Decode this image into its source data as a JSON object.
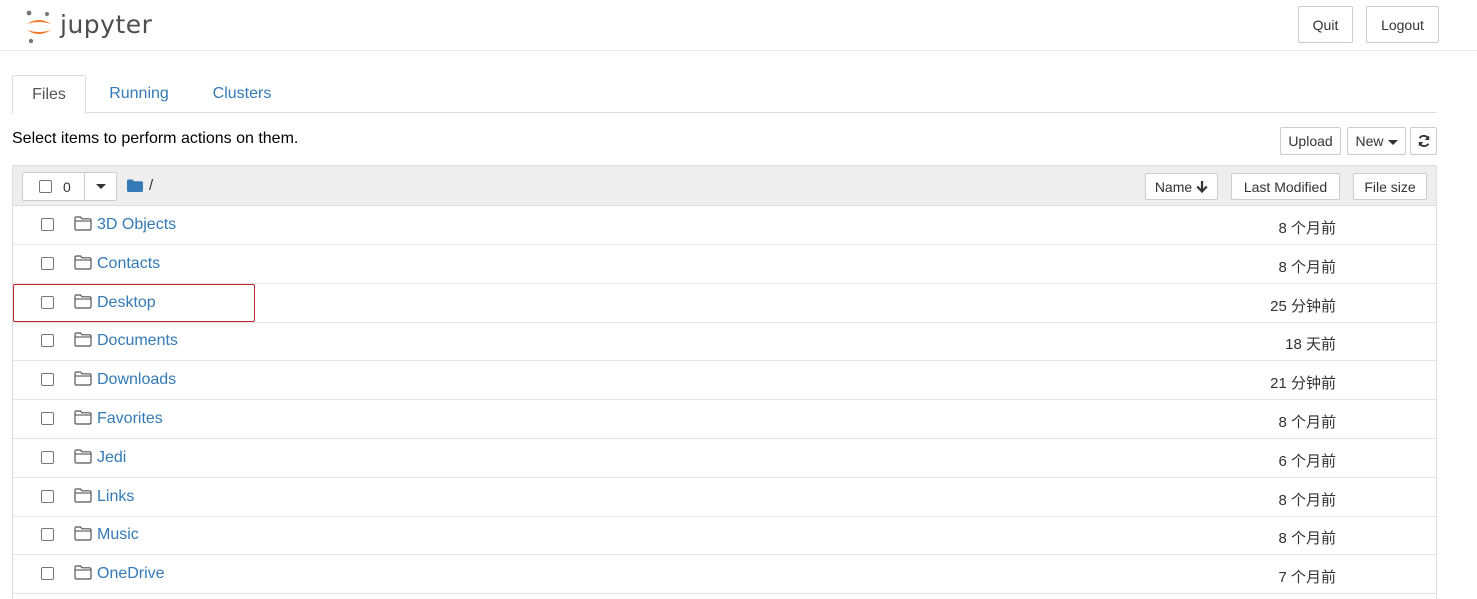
{
  "header": {
    "logo_text": "jupyter",
    "quit_label": "Quit",
    "logout_label": "Logout",
    "logo_colors": {
      "orange": "#f37726",
      "gray": "#767677"
    }
  },
  "tabs": [
    {
      "label": "Files",
      "active": true
    },
    {
      "label": "Running",
      "active": false
    },
    {
      "label": "Clusters",
      "active": false
    }
  ],
  "toolbar": {
    "instruction": "Select items to perform actions on them.",
    "upload_label": "Upload",
    "new_label": "New",
    "refresh_icon": "refresh-icon"
  },
  "list_header": {
    "selected_count": "0",
    "breadcrumb_root": "/",
    "breadcrumb_icon": "folder-icon",
    "sort_name_label": "Name",
    "sort_name_icon": "arrow-down-icon",
    "sort_modified_label": "Last Modified",
    "sort_size_label": "File size"
  },
  "items": [
    {
      "name": "3D Objects",
      "modified": "8 个月前",
      "icon": "folder-icon"
    },
    {
      "name": "Contacts",
      "modified": "8 个月前",
      "icon": "folder-icon"
    },
    {
      "name": "Desktop",
      "modified": "25 分钟前",
      "icon": "folder-icon",
      "highlighted": true
    },
    {
      "name": "Documents",
      "modified": "18 天前",
      "icon": "folder-icon"
    },
    {
      "name": "Downloads",
      "modified": "21 分钟前",
      "icon": "folder-icon"
    },
    {
      "name": "Favorites",
      "modified": "8 个月前",
      "icon": "folder-icon"
    },
    {
      "name": "Jedi",
      "modified": "6 个月前",
      "icon": "folder-icon"
    },
    {
      "name": "Links",
      "modified": "8 个月前",
      "icon": "folder-icon"
    },
    {
      "name": "Music",
      "modified": "8 个月前",
      "icon": "folder-icon"
    },
    {
      "name": "OneDrive",
      "modified": "7 个月前",
      "icon": "folder-icon"
    }
  ],
  "colors": {
    "link": "#337ab7",
    "highlight_border": "#c0272d",
    "header_bg": "#eeeeee"
  }
}
